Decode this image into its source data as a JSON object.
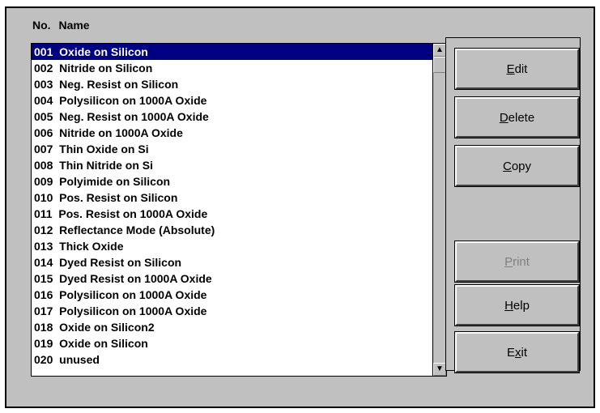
{
  "header": {
    "no_label": "No.",
    "name_label": "Name"
  },
  "list": {
    "selected_index": 0,
    "items": [
      {
        "no": "001",
        "name": "Oxide on Silicon"
      },
      {
        "no": "002",
        "name": "Nitride on Silicon"
      },
      {
        "no": "003",
        "name": "Neg. Resist on Silicon"
      },
      {
        "no": "004",
        "name": "Polysilicon on 1000A Oxide"
      },
      {
        "no": "005",
        "name": "Neg. Resist on 1000A Oxide"
      },
      {
        "no": "006",
        "name": "Nitride on 1000A Oxide"
      },
      {
        "no": "007",
        "name": "Thin Oxide on Si"
      },
      {
        "no": "008",
        "name": "Thin Nitride on Si"
      },
      {
        "no": "009",
        "name": "Polyimide on Silicon"
      },
      {
        "no": "010",
        "name": "Pos. Resist on Silicon"
      },
      {
        "no": "011",
        "name": "Pos. Resist on 1000A Oxide"
      },
      {
        "no": "012",
        "name": "Reflectance Mode (Absolute)"
      },
      {
        "no": "013",
        "name": "Thick Oxide"
      },
      {
        "no": "014",
        "name": "Dyed Resist on Silicon"
      },
      {
        "no": "015",
        "name": "Dyed Resist on 1000A Oxide"
      },
      {
        "no": "016",
        "name": "Polysilicon on 1000A Oxide"
      },
      {
        "no": "017",
        "name": "Polysilicon on 1000A Oxide"
      },
      {
        "no": "018",
        "name": "Oxide on Silicon2"
      },
      {
        "no": "019",
        "name": "Oxide on Silicon"
      },
      {
        "no": "020",
        "name": "unused"
      }
    ]
  },
  "scrollbar": {
    "up_icon": "arrow-up-icon",
    "down_icon": "arrow-down-icon"
  },
  "buttons": {
    "edit": {
      "pre": "",
      "key": "E",
      "post": "dit",
      "enabled": true
    },
    "delete": {
      "pre": "",
      "key": "D",
      "post": "elete",
      "enabled": true
    },
    "copy": {
      "pre": "",
      "key": "C",
      "post": "opy",
      "enabled": true
    },
    "print": {
      "pre": "",
      "key": "P",
      "post": "rint",
      "enabled": false
    },
    "help": {
      "pre": "",
      "key": "H",
      "post": "elp",
      "enabled": true
    },
    "exit": {
      "pre": "E",
      "key": "x",
      "post": "it",
      "enabled": true
    }
  }
}
